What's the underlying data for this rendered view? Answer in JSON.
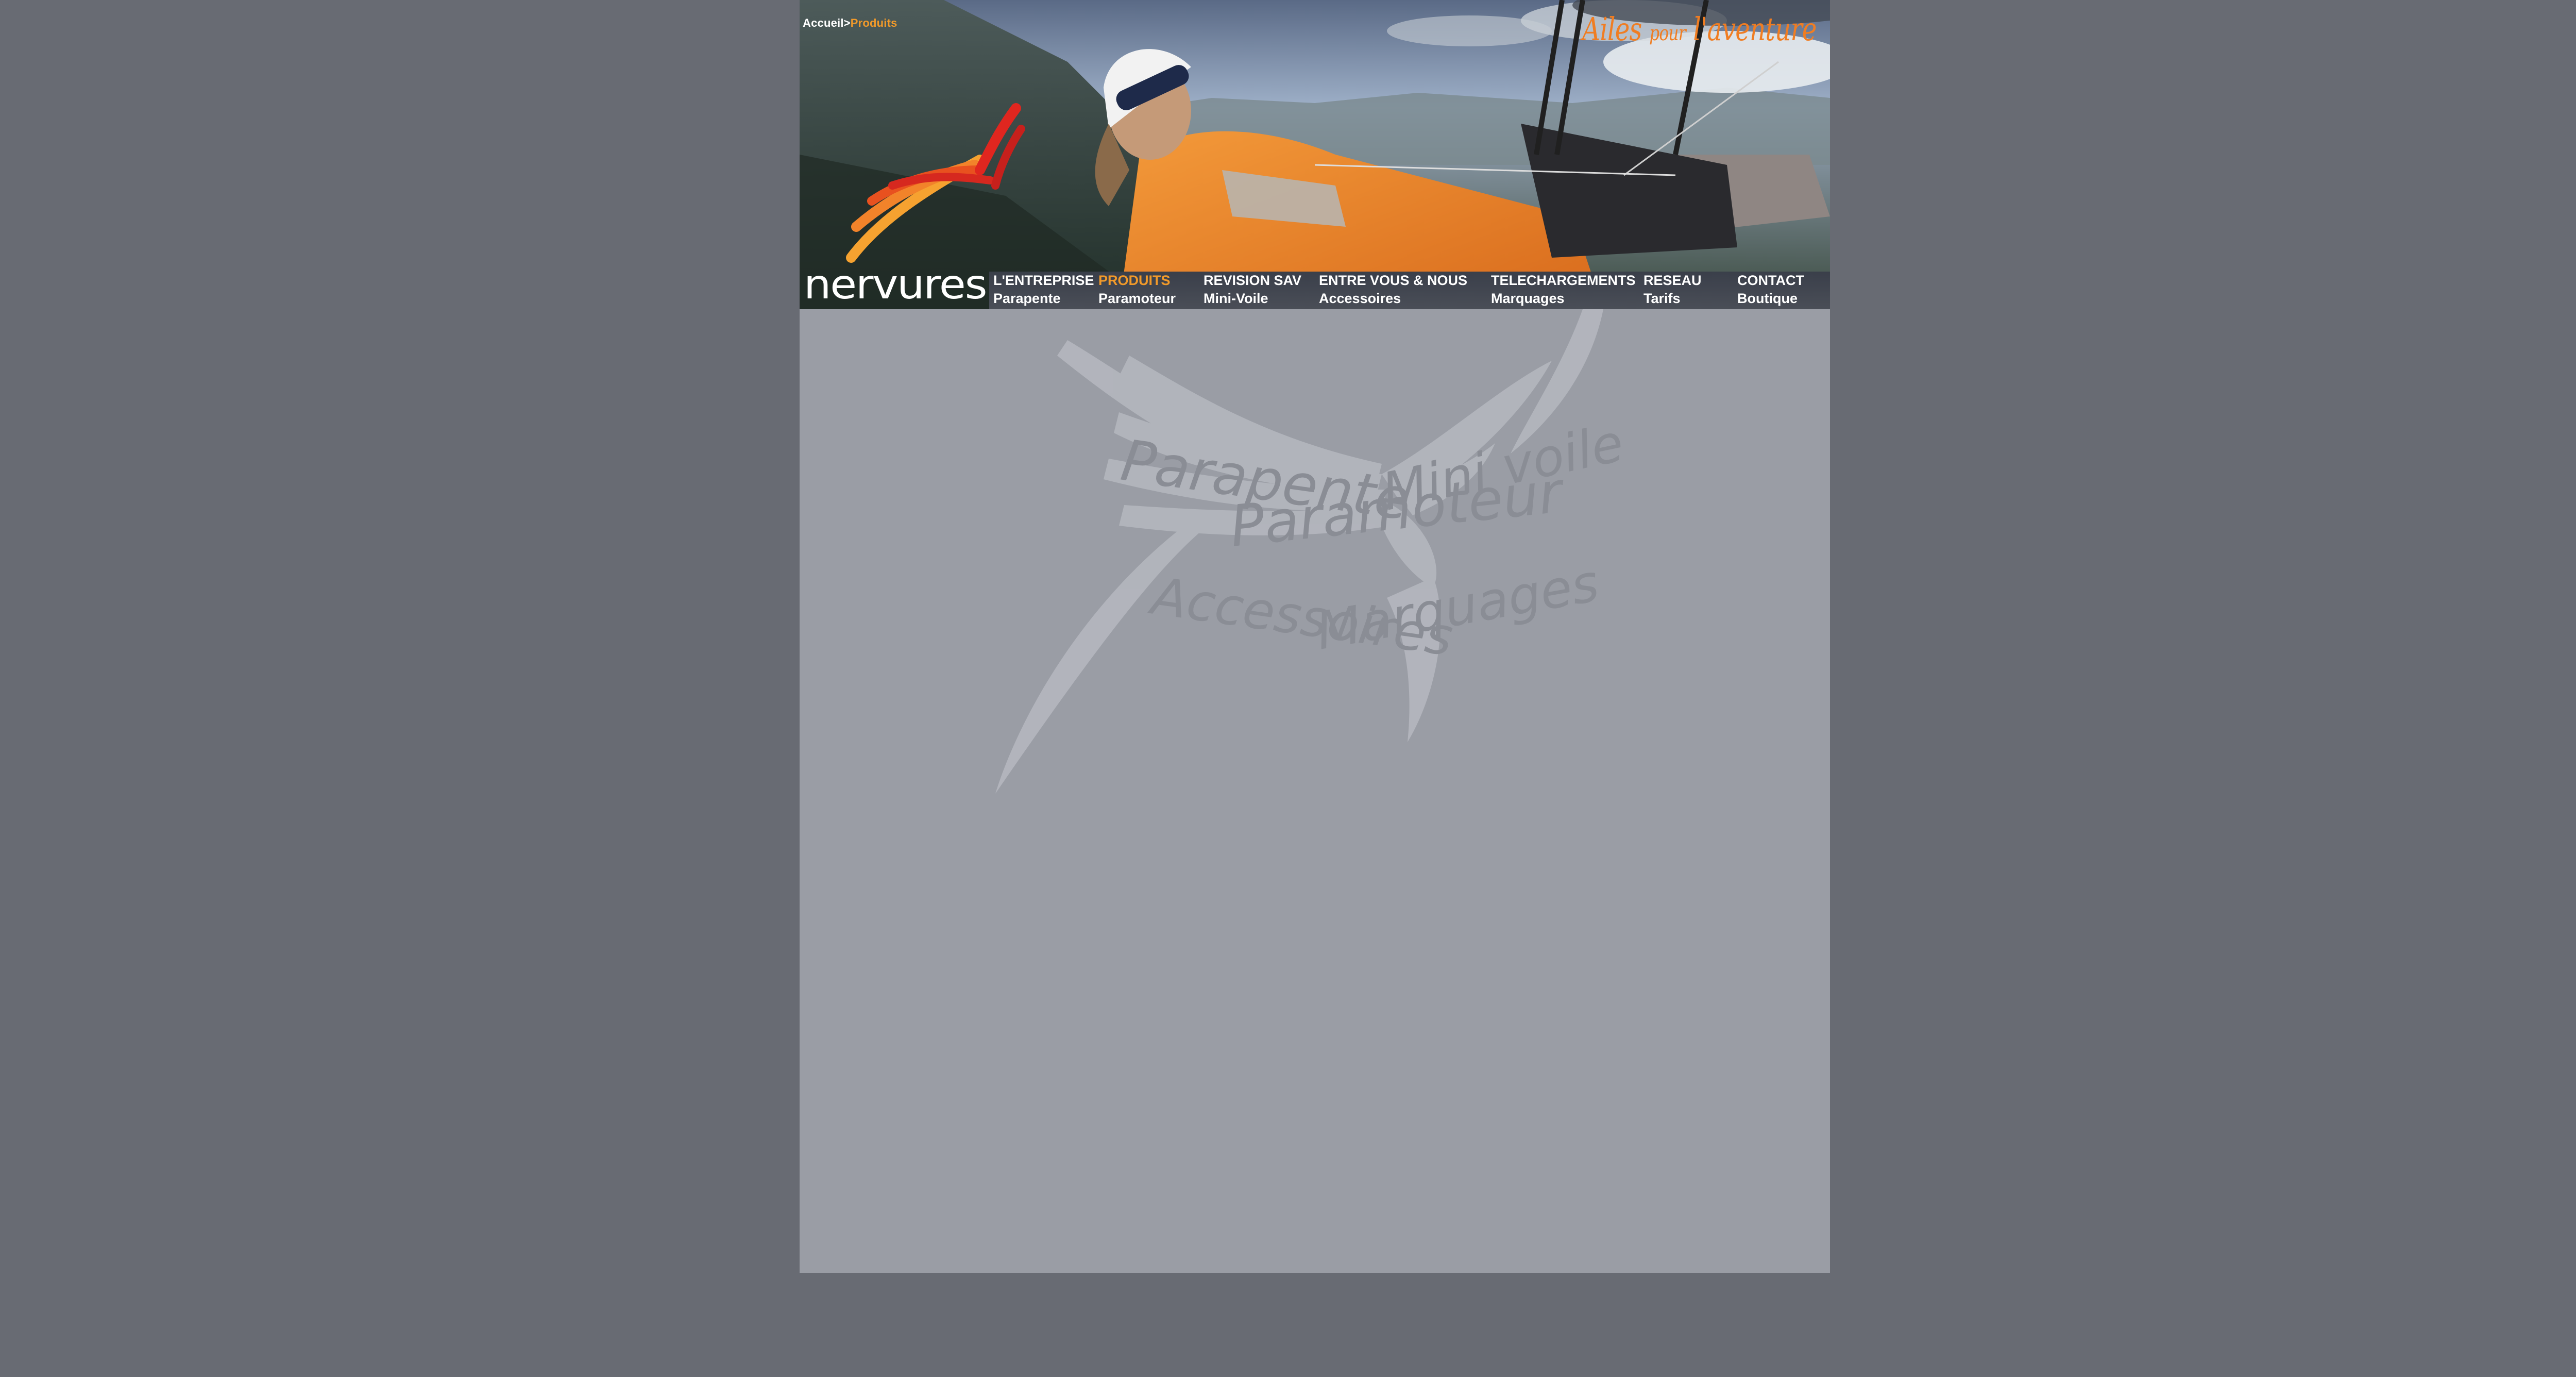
{
  "breadcrumb": {
    "home": "Accueil",
    "separator": ">",
    "current": "Produits"
  },
  "tagline": {
    "part1": "Ailes",
    "part2": "pour",
    "part3": "l'aventure"
  },
  "logo": {
    "text": "nervures"
  },
  "nav": {
    "top_row": [
      "L'ENTREPRISE",
      "PRODUITS",
      "REVISION SAV",
      "ENTRE VOUS & NOUS",
      "TELECHARGEMENTS",
      "RESEAU",
      "CONTACT"
    ],
    "bottom_row": [
      "Parapente",
      "Paramoteur",
      "Mini-Voile",
      "Accessoires",
      "Marquages",
      "Tarifs",
      "Boutique"
    ],
    "active": "PRODUITS"
  },
  "product_menu": {
    "items": [
      "Parapente",
      "Paramoteur",
      "Mini voile",
      "Accessoires",
      "Marquages"
    ]
  },
  "colors": {
    "page_bg": "#686b73",
    "content_bg": "#9a9da5",
    "accent": "#f29a2a",
    "tagline": "#f07d22"
  },
  "icons": {
    "logo_mark": "nervures-wing-icon",
    "emblem": "wing-emblem-icon"
  }
}
